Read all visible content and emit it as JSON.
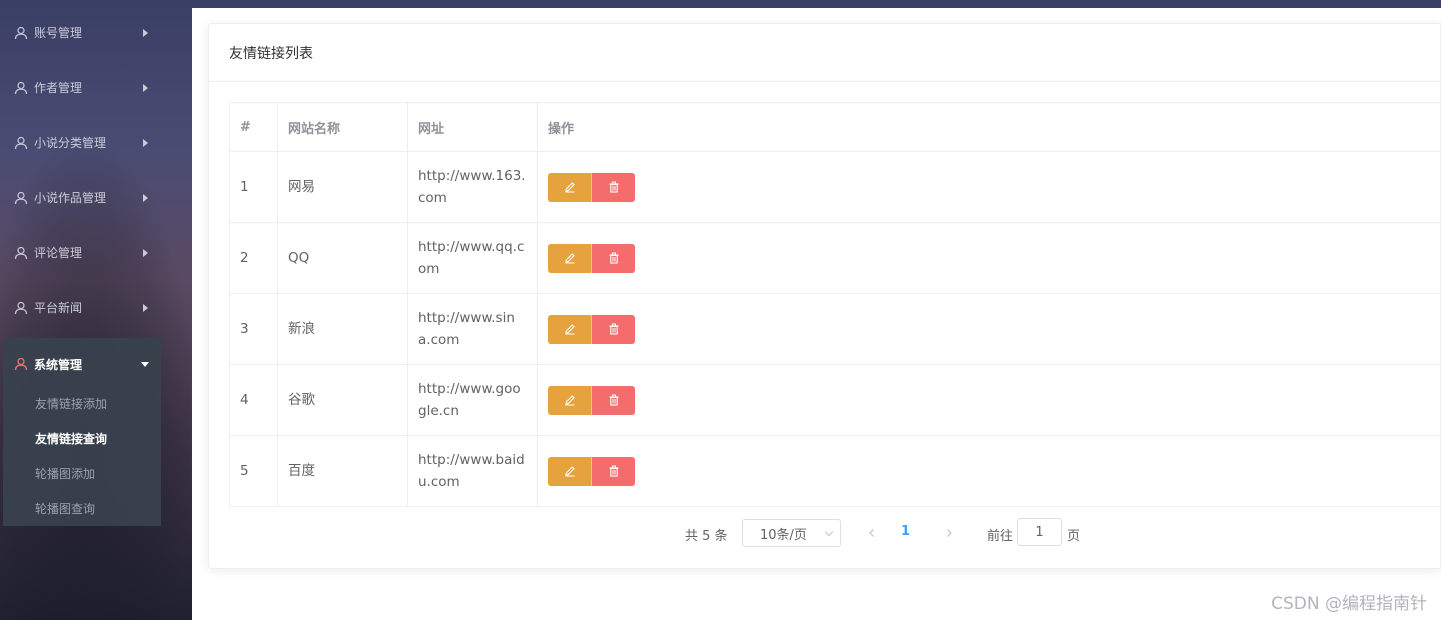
{
  "sidebar": {
    "menus": [
      {
        "label": "账号管理"
      },
      {
        "label": "作者管理"
      },
      {
        "label": "小说分类管理"
      },
      {
        "label": "小说作品管理"
      },
      {
        "label": "评论管理"
      },
      {
        "label": "平台新闻"
      }
    ],
    "open_menu": {
      "label": "系统管理",
      "items": [
        {
          "label": "友情链接添加",
          "active": false
        },
        {
          "label": "友情链接查询",
          "active": true
        },
        {
          "label": "轮播图添加",
          "active": false
        },
        {
          "label": "轮播图查询",
          "active": false
        }
      ]
    }
  },
  "card": {
    "title": "友情链接列表"
  },
  "table": {
    "headers": [
      "#",
      "网站名称",
      "网址",
      "操作"
    ],
    "rows": [
      {
        "id": "1",
        "name": "网易",
        "url": "http://www.163.com"
      },
      {
        "id": "2",
        "name": "QQ",
        "url": "http://www.qq.com"
      },
      {
        "id": "3",
        "name": "新浪",
        "url": "http://www.sina.com"
      },
      {
        "id": "4",
        "name": "谷歌",
        "url": "http://www.google.cn"
      },
      {
        "id": "5",
        "name": "百度",
        "url": "http://www.baidu.com"
      }
    ]
  },
  "pagination": {
    "total": "共 5 条",
    "page_size": "10条/页",
    "current_page": "1",
    "goto_label": "前往",
    "goto_value": "1",
    "page_unit": "页"
  },
  "watermark": "CSDN @编程指南针",
  "colors": {
    "edit": "#e6a23c",
    "delete": "#f56c6c",
    "active_page": "#409eff",
    "active_menu_icon": "#f56c6c"
  }
}
